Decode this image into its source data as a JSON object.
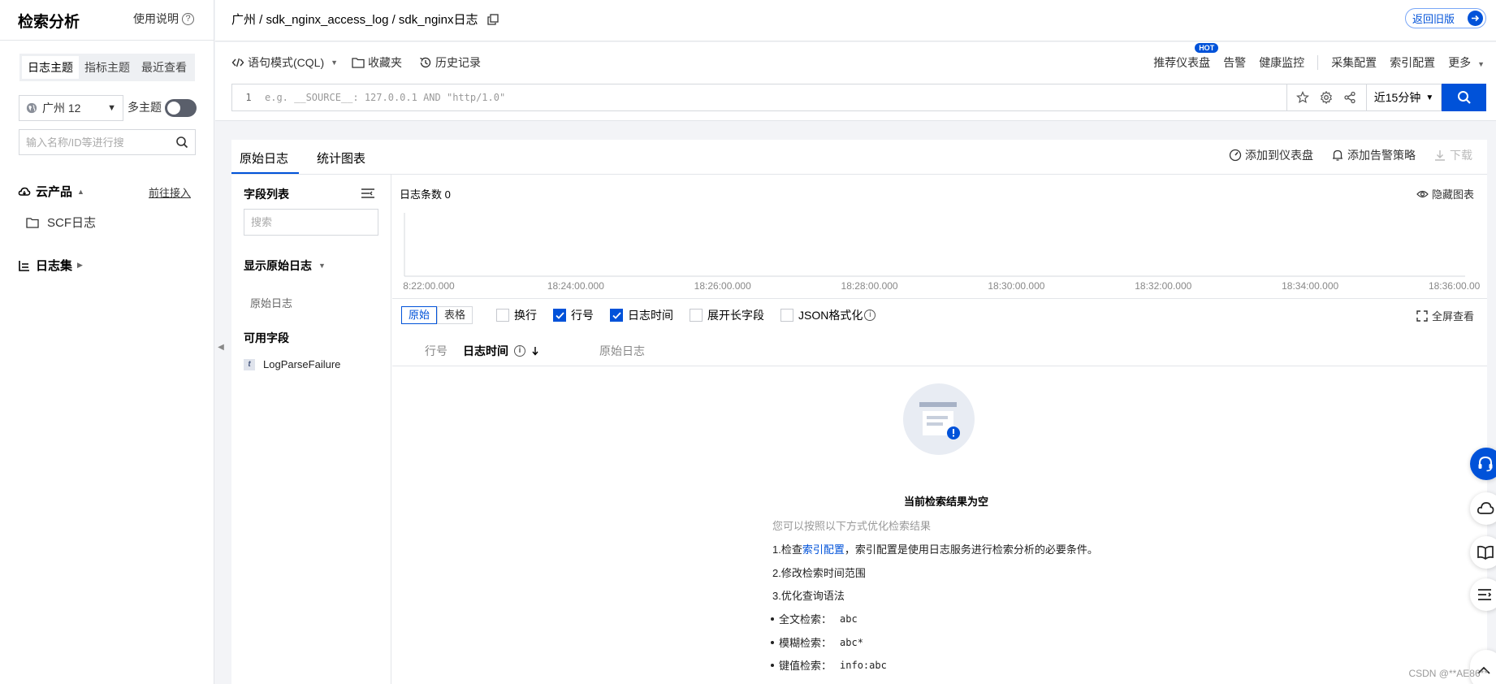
{
  "sidebar": {
    "title": "检索分析",
    "help_label": "使用说明",
    "tabs": [
      "日志主题",
      "指标主题",
      "最近查看"
    ],
    "region_label": "广州 12",
    "multi_topic_label": "多主题",
    "search_placeholder": "输入名称/ID等进行搜",
    "cloud_products_label": "云产品",
    "goto_access_label": "前往接入",
    "scf_label": "SCF日志",
    "logsets_label": "日志集"
  },
  "header": {
    "breadcrumb": "广州 / sdk_nginx_access_log / sdk_nginx日志",
    "back_old_label": "返回旧版"
  },
  "toolbar": {
    "syntax_mode_label": "语句模式(CQL)",
    "favorites_label": "收藏夹",
    "history_label": "历史记录",
    "hot_badge": "HOT",
    "right_items": [
      "推荐仪表盘",
      "告警",
      "健康监控",
      "采集配置",
      "索引配置",
      "更多"
    ],
    "query_line_no": "1",
    "query_placeholder": "e.g. __SOURCE__: 127.0.0.1 AND \"http/1.0\"",
    "time_range": "近15分钟"
  },
  "panel": {
    "tabs": [
      "原始日志",
      "统计图表"
    ],
    "actions": {
      "add_dashboard": "添加到仪表盘",
      "add_alarm": "添加告警策略",
      "download": "下载"
    },
    "fields": {
      "title": "字段列表",
      "search_placeholder": "搜索",
      "show_raw_label": "显示原始日志",
      "raw_item": "原始日志",
      "available_label": "可用字段",
      "available_fields": [
        {
          "type": "t",
          "name": "LogParseFailure"
        }
      ]
    },
    "log_count_label": "日志条数 0",
    "hide_chart_label": "隐藏图表",
    "view_modes": [
      "原始",
      "表格"
    ],
    "options": [
      {
        "label": "换行",
        "checked": false
      },
      {
        "label": "行号",
        "checked": true
      },
      {
        "label": "日志时间",
        "checked": true
      },
      {
        "label": "展开长字段",
        "checked": false
      },
      {
        "label": "JSON格式化",
        "checked": false
      }
    ],
    "fullscreen_label": "全屏查看",
    "table_headers": [
      "行号",
      "日志时间",
      "原始日志"
    ],
    "empty": {
      "title": "当前检索结果为空",
      "subtitle": "您可以按照以下方式优化检索结果",
      "step1_prefix": "1.检查",
      "step1_link": "索引配置",
      "step1_suffix": "，索引配置是使用日志服务进行检索分析的必要条件。",
      "step2": "2.修改检索时间范围",
      "step3": "3.优化查询语法",
      "examples": [
        {
          "label": "全文检索：",
          "code": "abc"
        },
        {
          "label": "模糊检索：",
          "code": "abc*"
        },
        {
          "label": "键值检索：",
          "code": "info:abc"
        }
      ]
    }
  },
  "chart_data": {
    "type": "bar",
    "title": "",
    "x": [
      "8:22:00.000",
      "18:24:00.000",
      "18:26:00.000",
      "18:28:00.000",
      "18:30:00.000",
      "18:32:00.000",
      "18:34:00.000",
      "18:36:00.000"
    ],
    "values": [
      0,
      0,
      0,
      0,
      0,
      0,
      0,
      0
    ],
    "grid": false
  },
  "watermark": "CSDN @**AE86**",
  "colors": {
    "accent": "#0052d9",
    "border": "#e3e5e9",
    "bg": "#f3f4f7"
  }
}
